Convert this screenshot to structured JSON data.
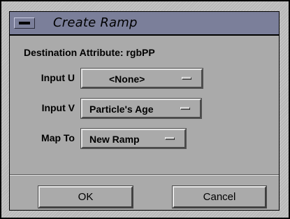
{
  "window": {
    "title": "Create Ramp"
  },
  "destination_text": "Destination Attribute: rgbPP",
  "fields": [
    {
      "label": "Input U",
      "value": "<None>"
    },
    {
      "label": "Input V",
      "value": "Particle's Age"
    },
    {
      "label": "Map To",
      "value": "New Ramp"
    }
  ],
  "buttons": {
    "ok": "OK",
    "cancel": "Cancel"
  },
  "colors": {
    "titlebar": "#7b7f9a",
    "panel": "#aaaaaa",
    "frame_texture": "#bcbcbc"
  },
  "icons": {
    "window_menu": "window-menu-icon",
    "option_indicator": "option-menu-indicator-icon"
  }
}
